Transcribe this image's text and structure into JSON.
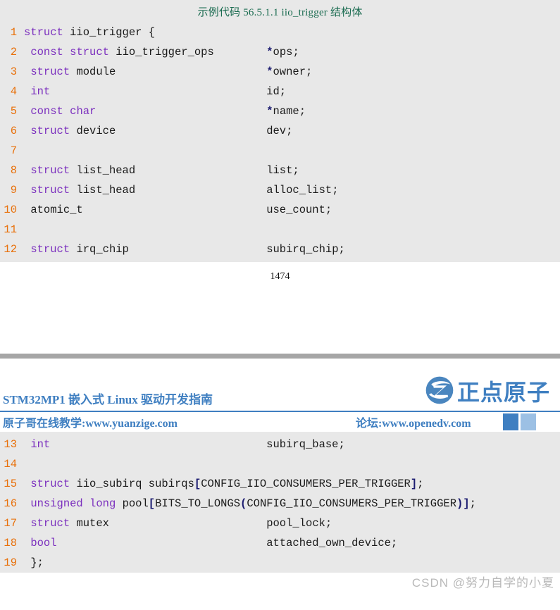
{
  "document": {
    "page_number": "1474",
    "watermark": "CSDN @努力自学的小夏"
  },
  "code_top": {
    "caption": "示例代码 56.5.1.1 iio_trigger 结构体",
    "lines": [
      {
        "n": "1",
        "indent": 0,
        "decl": "struct iio_trigger {",
        "member": ""
      },
      {
        "n": "2",
        "indent": 1,
        "decl": "const struct iio_trigger_ops",
        "member": "*ops;"
      },
      {
        "n": "3",
        "indent": 1,
        "decl": "struct module",
        "member": "*owner;"
      },
      {
        "n": "4",
        "indent": 1,
        "decl": "int",
        "member": "id;"
      },
      {
        "n": "5",
        "indent": 1,
        "decl": "const char",
        "member": "*name;"
      },
      {
        "n": "6",
        "indent": 1,
        "decl": "struct device",
        "member": "dev;"
      },
      {
        "n": "7",
        "indent": 1,
        "decl": "",
        "member": ""
      },
      {
        "n": "8",
        "indent": 1,
        "decl": "struct list_head",
        "member": "list;"
      },
      {
        "n": "9",
        "indent": 1,
        "decl": "struct list_head",
        "member": "alloc_list;"
      },
      {
        "n": "10",
        "indent": 1,
        "decl": "atomic_t",
        "member": "use_count;"
      },
      {
        "n": "11",
        "indent": 1,
        "decl": "",
        "member": ""
      },
      {
        "n": "12",
        "indent": 1,
        "decl": "struct irq_chip",
        "member": "subirq_chip;"
      }
    ]
  },
  "header": {
    "title": "STM32MP1 嵌入式 Linux 驱动开发指南",
    "subtitle_left": "原子哥在线教学:www.yuanzige.com",
    "subtitle_right": "论坛:www.openedv.com",
    "logo_text": "正点原子",
    "brand_color": "#3f7fc1"
  },
  "code_bottom": {
    "lines": [
      {
        "n": "13",
        "indent": 1,
        "decl": "int",
        "member": "subirq_base;"
      },
      {
        "n": "14",
        "indent": 1,
        "decl": "",
        "member": ""
      },
      {
        "n": "15",
        "indent": 1,
        "decl": "struct iio_subirq subirqs[CONFIG_IIO_CONSUMERS_PER_TRIGGER];",
        "member": ""
      },
      {
        "n": "16",
        "indent": 1,
        "decl": "unsigned long pool[BITS_TO_LONGS(CONFIG_IIO_CONSUMERS_PER_TRIGGER)];",
        "member": ""
      },
      {
        "n": "17",
        "indent": 1,
        "decl": "struct mutex",
        "member": "pool_lock;"
      },
      {
        "n": "18",
        "indent": 1,
        "decl": "bool",
        "member": "attached_own_device;"
      },
      {
        "n": "19",
        "indent": 1,
        "decl": "};",
        "member": ""
      }
    ]
  },
  "syntax": {
    "keywords": [
      "struct",
      "const",
      "int",
      "char",
      "unsigned",
      "long",
      "bool"
    ],
    "line_number_color": "#e8700a",
    "keyword_color": "#7b2fbe",
    "pointer_color": "#1b1b70",
    "caption_color": "#1a6b50",
    "code_background": "#e8e8e8"
  }
}
